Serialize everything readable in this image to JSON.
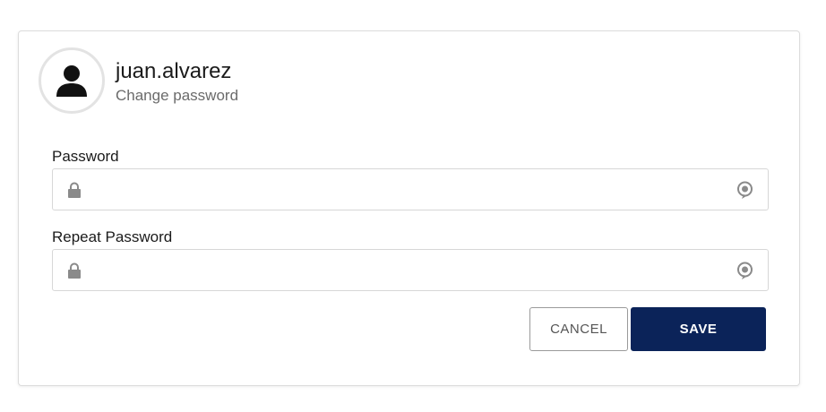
{
  "profile": {
    "username": "juan.alvarez",
    "subtitle": "Change password",
    "avatar_icon": "user-icon"
  },
  "form": {
    "password": {
      "label": "Password",
      "value": "",
      "placeholder": "",
      "left_icon": "lock-icon",
      "right_icon": "eye-reveal-icon"
    },
    "repeat_password": {
      "label": "Repeat Password",
      "value": "",
      "placeholder": "",
      "left_icon": "lock-icon",
      "right_icon": "eye-reveal-icon"
    }
  },
  "actions": {
    "cancel_label": "CANCEL",
    "save_label": "SAVE"
  },
  "colors": {
    "primary": "#0b2359",
    "border": "#d7d7d7",
    "icon": "#8a8a8a"
  }
}
